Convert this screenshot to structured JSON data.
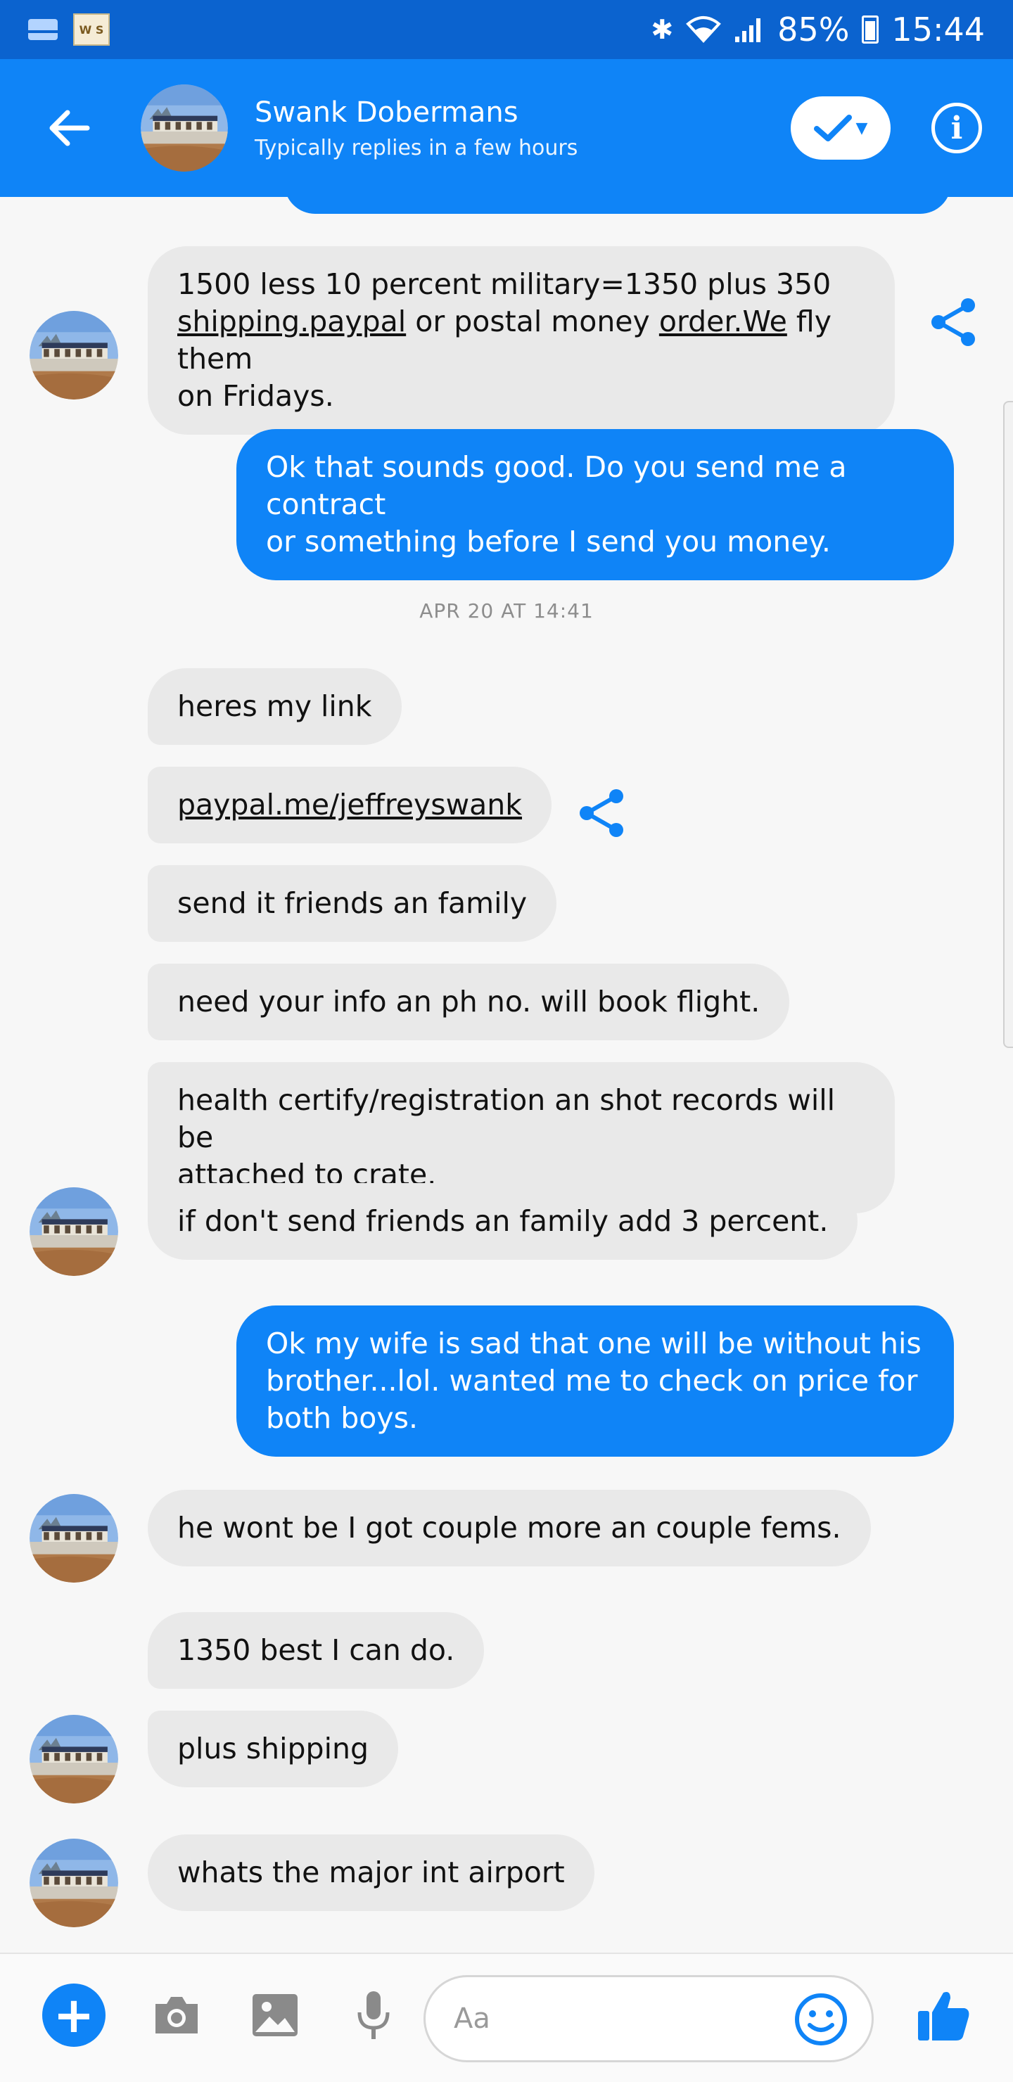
{
  "status_bar": {
    "left_app_label": "W S",
    "battery_percent": "85%",
    "time": "15:44"
  },
  "header": {
    "name": "Swank Dobermans",
    "subtitle": "Typically replies in a few hours"
  },
  "messages": [
    {
      "id": "m1",
      "from": "them",
      "text_parts": [
        "1500 less 10 percent military=1350 plus 350",
        "shipping.paypal",
        "or postal money",
        "order.We",
        "fly them",
        "on Fridays."
      ]
    },
    {
      "id": "m2",
      "from": "me",
      "lines": [
        "Ok that sounds good. Do you send me a contract",
        "or something before I send you money."
      ]
    },
    {
      "id": "ts1",
      "type": "timestamp",
      "text": "APR 20 AT 14:41"
    },
    {
      "id": "m3",
      "from": "them",
      "text": "heres my link"
    },
    {
      "id": "m4",
      "from": "them",
      "text": "paypal.me/jeffreyswank"
    },
    {
      "id": "m5",
      "from": "them",
      "text": "send it friends an family"
    },
    {
      "id": "m6",
      "from": "them",
      "text": "need your info an ph no. will book flight."
    },
    {
      "id": "m7",
      "from": "them",
      "lines": [
        "health certify/registration an shot records will be",
        "attached to crate."
      ]
    },
    {
      "id": "m8",
      "from": "them",
      "text": "if don't send friends an family add 3 percent."
    },
    {
      "id": "m9",
      "from": "me",
      "lines": [
        "Ok my wife is sad that one will be without his",
        "brother...lol. wanted me to check on price for",
        "both boys."
      ]
    },
    {
      "id": "m10",
      "from": "them",
      "text": "he wont be I got couple more an couple fems."
    },
    {
      "id": "m11",
      "from": "them",
      "text": "1350 best I can do."
    },
    {
      "id": "m12",
      "from": "them",
      "text": "plus shipping"
    },
    {
      "id": "m13",
      "from": "them",
      "text": "whats the major int airport"
    }
  ],
  "composer": {
    "placeholder": "Aa"
  },
  "icons": {
    "back": "arrow-left-icon",
    "check": "check-icon",
    "info": "info-icon",
    "share": "share-icon",
    "plus": "plus-icon",
    "camera": "camera-icon",
    "gallery": "image-icon",
    "mic": "microphone-icon",
    "emoji": "emoji-icon",
    "like": "thumbs-up-icon"
  },
  "colors": {
    "messenger_blue": "#0f84f7",
    "status_bar_blue": "#0b63cf",
    "incoming_bubble": "#e9e9e9",
    "background": "#f7f7f7"
  }
}
